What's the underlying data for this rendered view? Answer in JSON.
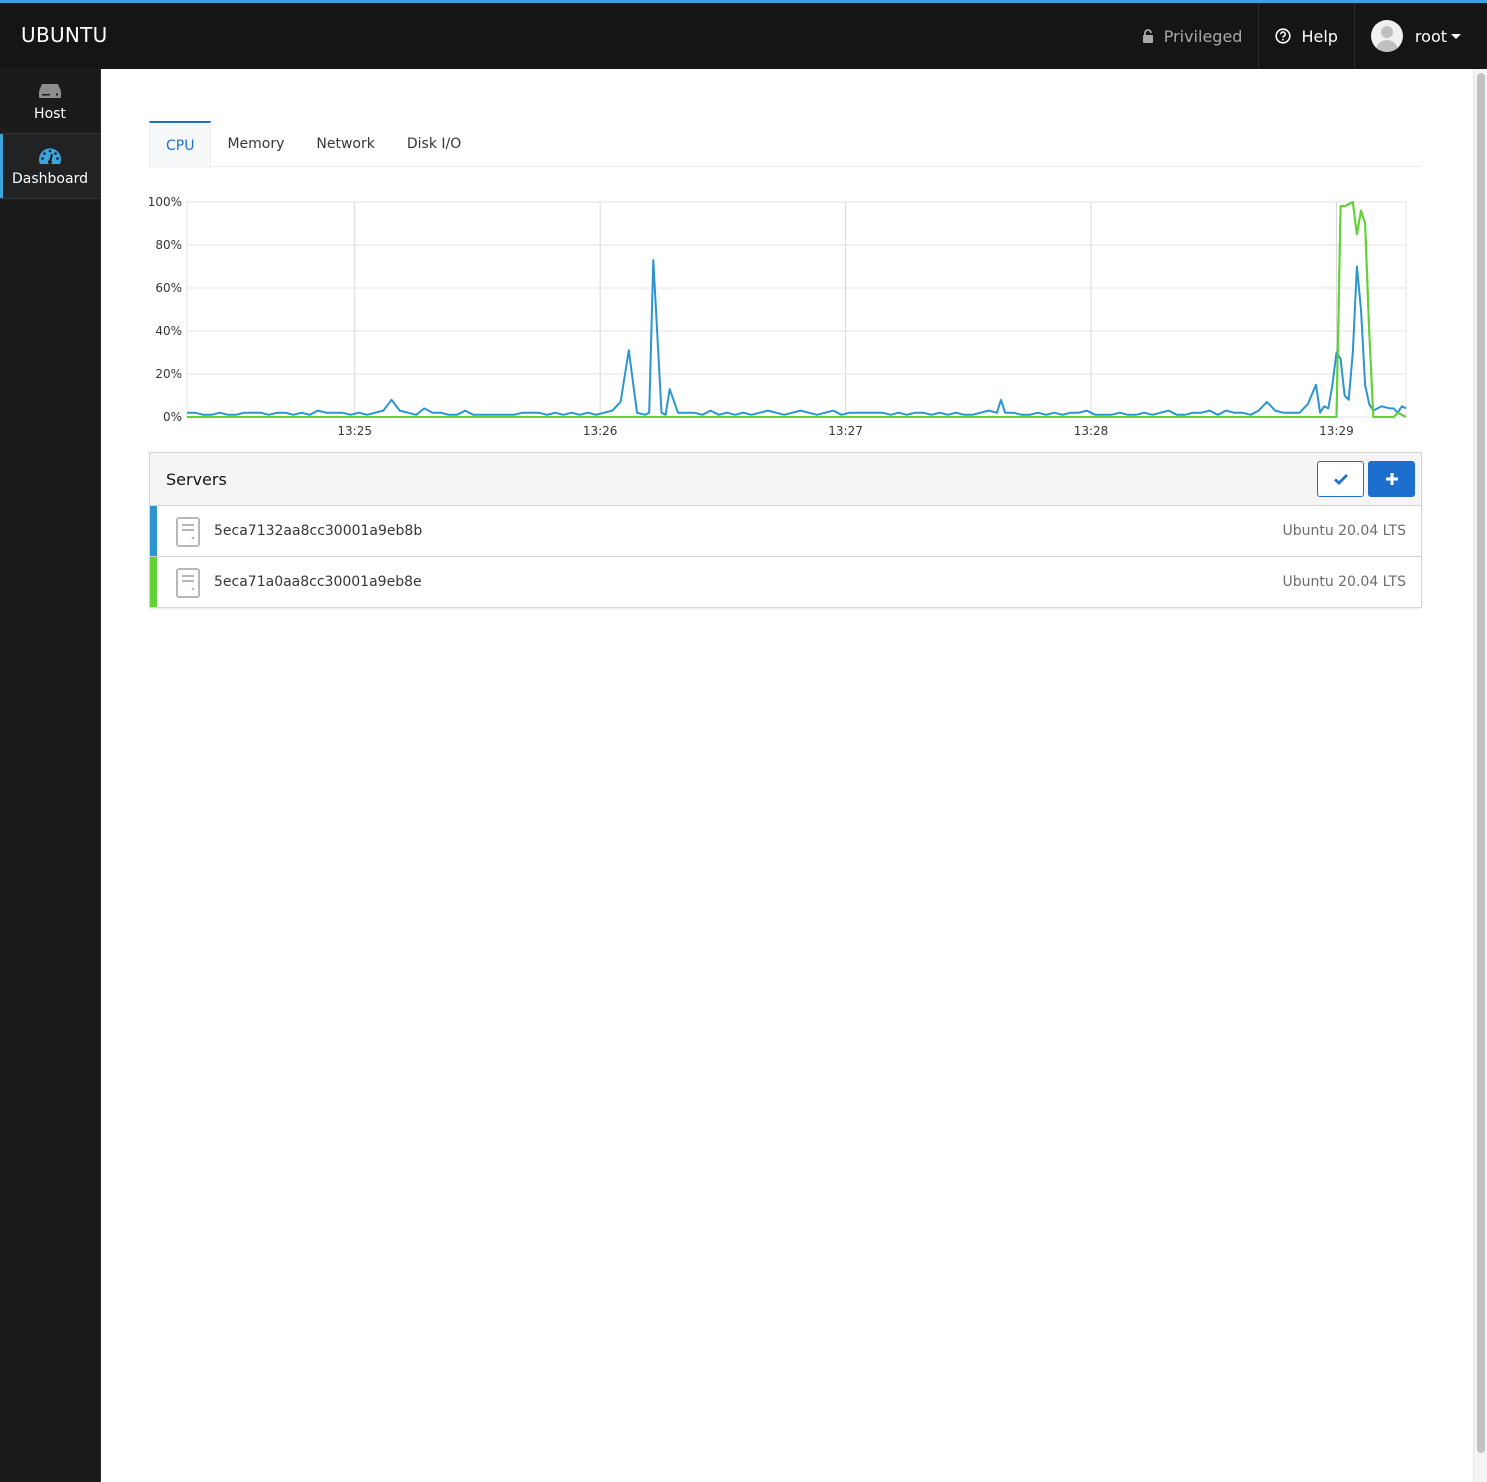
{
  "masthead": {
    "brand": "UBUNTU",
    "privileged_label": "Privileged",
    "help_label": "Help",
    "user_label": "root",
    "accent_color": "#39a5dc"
  },
  "sidebar": {
    "items": [
      {
        "label": "Host",
        "icon": "server-icon",
        "active": false
      },
      {
        "label": "Dashboard",
        "icon": "dashboard-gauge-icon",
        "active": true
      }
    ]
  },
  "tabs": [
    {
      "label": "CPU",
      "active": true
    },
    {
      "label": "Memory",
      "active": false
    },
    {
      "label": "Network",
      "active": false
    },
    {
      "label": "Disk I/O",
      "active": false
    }
  ],
  "chart_data": {
    "type": "line",
    "title": "",
    "xlabel": "",
    "ylabel": "",
    "x_unit": "seconds since 13:24:19",
    "xlim": [
      0,
      298
    ],
    "ylim": [
      0,
      100
    ],
    "yticks": [
      0,
      20,
      40,
      60,
      80,
      100
    ],
    "ytick_labels": [
      "0%",
      "20%",
      "40%",
      "60%",
      "80%",
      "100%"
    ],
    "xticks": [
      41,
      101,
      161,
      221,
      281
    ],
    "xtick_labels": [
      "13:25",
      "13:26",
      "13:27",
      "13:28",
      "13:29"
    ],
    "grid": true,
    "legend": "none",
    "series": [
      {
        "name": "5eca7132aa8cc30001a9eb8b",
        "color": "#2b95d1",
        "points": [
          [
            0,
            2
          ],
          [
            2,
            2
          ],
          [
            4,
            1
          ],
          [
            6,
            1
          ],
          [
            8,
            2
          ],
          [
            10,
            1
          ],
          [
            12,
            1
          ],
          [
            14,
            2
          ],
          [
            16,
            2
          ],
          [
            18,
            2
          ],
          [
            20,
            1
          ],
          [
            22,
            2
          ],
          [
            24,
            2
          ],
          [
            26,
            1
          ],
          [
            28,
            2
          ],
          [
            30,
            1
          ],
          [
            32,
            3
          ],
          [
            34,
            2
          ],
          [
            36,
            2
          ],
          [
            38,
            2
          ],
          [
            40,
            1
          ],
          [
            42,
            2
          ],
          [
            44,
            1
          ],
          [
            46,
            2
          ],
          [
            48,
            3
          ],
          [
            50,
            8
          ],
          [
            52,
            3
          ],
          [
            54,
            2
          ],
          [
            56,
            1
          ],
          [
            58,
            4
          ],
          [
            60,
            2
          ],
          [
            62,
            2
          ],
          [
            64,
            1
          ],
          [
            66,
            1
          ],
          [
            68,
            3
          ],
          [
            70,
            1
          ],
          [
            72,
            1
          ],
          [
            74,
            1
          ],
          [
            76,
            1
          ],
          [
            78,
            1
          ],
          [
            80,
            1
          ],
          [
            82,
            2
          ],
          [
            84,
            2
          ],
          [
            86,
            2
          ],
          [
            88,
            1
          ],
          [
            90,
            2
          ],
          [
            92,
            1
          ],
          [
            94,
            2
          ],
          [
            96,
            1
          ],
          [
            98,
            2
          ],
          [
            100,
            1
          ],
          [
            102,
            2
          ],
          [
            104,
            3
          ],
          [
            106,
            7
          ],
          [
            108,
            31
          ],
          [
            110,
            2
          ],
          [
            112,
            1
          ],
          [
            113,
            2
          ],
          [
            114,
            73
          ],
          [
            116,
            2
          ],
          [
            117,
            1
          ],
          [
            118,
            13
          ],
          [
            120,
            2
          ],
          [
            122,
            2
          ],
          [
            124,
            2
          ],
          [
            126,
            1
          ],
          [
            128,
            3
          ],
          [
            130,
            1
          ],
          [
            132,
            2
          ],
          [
            134,
            1
          ],
          [
            136,
            2
          ],
          [
            138,
            1
          ],
          [
            140,
            2
          ],
          [
            142,
            3
          ],
          [
            144,
            2
          ],
          [
            146,
            1
          ],
          [
            148,
            2
          ],
          [
            150,
            3
          ],
          [
            152,
            2
          ],
          [
            154,
            1
          ],
          [
            156,
            2
          ],
          [
            158,
            3
          ],
          [
            160,
            1
          ],
          [
            162,
            2
          ],
          [
            164,
            2
          ],
          [
            166,
            2
          ],
          [
            168,
            2
          ],
          [
            170,
            2
          ],
          [
            172,
            1
          ],
          [
            174,
            2
          ],
          [
            176,
            1
          ],
          [
            178,
            2
          ],
          [
            180,
            2
          ],
          [
            182,
            1
          ],
          [
            184,
            2
          ],
          [
            186,
            1
          ],
          [
            188,
            2
          ],
          [
            190,
            1
          ],
          [
            192,
            1
          ],
          [
            194,
            2
          ],
          [
            196,
            3
          ],
          [
            198,
            2
          ],
          [
            199,
            8
          ],
          [
            200,
            2
          ],
          [
            202,
            2
          ],
          [
            204,
            1
          ],
          [
            206,
            1
          ],
          [
            208,
            2
          ],
          [
            210,
            1
          ],
          [
            212,
            2
          ],
          [
            214,
            1
          ],
          [
            216,
            2
          ],
          [
            218,
            2
          ],
          [
            220,
            3
          ],
          [
            222,
            1
          ],
          [
            224,
            1
          ],
          [
            226,
            1
          ],
          [
            228,
            2
          ],
          [
            230,
            1
          ],
          [
            232,
            1
          ],
          [
            234,
            2
          ],
          [
            236,
            1
          ],
          [
            238,
            2
          ],
          [
            240,
            3
          ],
          [
            242,
            1
          ],
          [
            244,
            1
          ],
          [
            246,
            2
          ],
          [
            248,
            2
          ],
          [
            250,
            3
          ],
          [
            252,
            1
          ],
          [
            254,
            3
          ],
          [
            256,
            2
          ],
          [
            258,
            2
          ],
          [
            260,
            1
          ],
          [
            262,
            3
          ],
          [
            264,
            7
          ],
          [
            266,
            3
          ],
          [
            268,
            2
          ],
          [
            270,
            2
          ],
          [
            272,
            2
          ],
          [
            274,
            6
          ],
          [
            276,
            15
          ],
          [
            277,
            2
          ],
          [
            278,
            5
          ],
          [
            279,
            4
          ],
          [
            280,
            15
          ],
          [
            281,
            30
          ],
          [
            282,
            27
          ],
          [
            283,
            10
          ],
          [
            284,
            8
          ],
          [
            285,
            30
          ],
          [
            286,
            70
          ],
          [
            287,
            50
          ],
          [
            288,
            15
          ],
          [
            289,
            6
          ],
          [
            290,
            3
          ],
          [
            292,
            5
          ],
          [
            294,
            4
          ],
          [
            295,
            4
          ],
          [
            296,
            2
          ],
          [
            297,
            5
          ],
          [
            298,
            4
          ]
        ]
      },
      {
        "name": "5eca71a0aa8cc30001a9eb8e",
        "color": "#62d136",
        "points": [
          [
            0,
            0
          ],
          [
            280,
            0
          ],
          [
            281,
            0
          ],
          [
            282,
            98
          ],
          [
            283,
            98
          ],
          [
            284,
            99
          ],
          [
            285,
            100
          ],
          [
            286,
            85
          ],
          [
            287,
            96
          ],
          [
            288,
            90
          ],
          [
            289,
            40
          ],
          [
            290,
            0
          ],
          [
            295,
            0
          ],
          [
            296,
            2
          ],
          [
            297,
            1
          ],
          [
            298,
            0
          ]
        ]
      }
    ]
  },
  "servers": {
    "title": "Servers",
    "check_button_icon": "checkmark-icon",
    "add_button_icon": "plus-icon",
    "rows": [
      {
        "name": "5eca7132aa8cc30001a9eb8b",
        "os": "Ubuntu 20.04 LTS",
        "color": "#2b95d1"
      },
      {
        "name": "5eca71a0aa8cc30001a9eb8e",
        "os": "Ubuntu 20.04 LTS",
        "color": "#62d136"
      }
    ]
  }
}
